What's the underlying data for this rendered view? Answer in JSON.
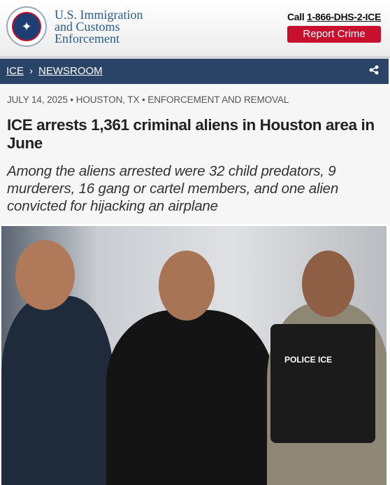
{
  "header": {
    "agency_lines": [
      "U.S. Immigration",
      "and Customs",
      "Enforcement"
    ],
    "call_prefix": "Call",
    "phone": "1-866-DHS-2-ICE",
    "report_button": "Report Crime"
  },
  "nav": {
    "breadcrumb": [
      {
        "label": "ICE"
      },
      {
        "label": "NEWSROOM"
      }
    ],
    "separator": "›",
    "share_icon": "share-icon"
  },
  "article": {
    "meta": "JULY 14, 2025 • HOUSTON, TX • ENFORCEMENT AND REMOVAL",
    "title": "ICE arrests 1,361 criminal aliens in Houston area in June",
    "subtitle": "Among the aliens arrested were 32 child predators, 9 murderers, 16 gang or cartel members, and one alien convicted for hijacking an airplane"
  },
  "photo": {
    "vest_text": "POLICE ICE"
  },
  "colors": {
    "nav": "#2a4468",
    "report": "#c8102e",
    "agency": "#2a5b8c"
  }
}
